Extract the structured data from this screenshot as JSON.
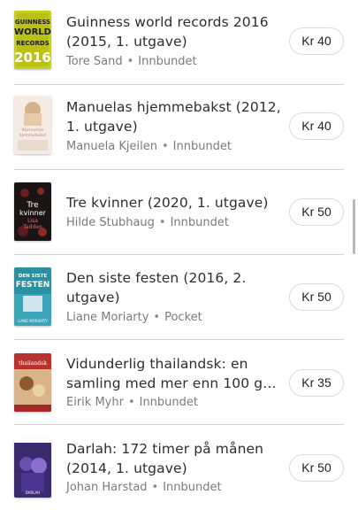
{
  "colors": {
    "divider": "#ecc3c6",
    "price_border": "#d9d9d9",
    "meta_text": "#7a7a7a"
  },
  "separator": "•",
  "books": [
    {
      "title_line1": "Guinness world records 2016",
      "title_line2": "(2015, 1. utgave)",
      "author": "Tore Sand",
      "format": "Innbundet",
      "price": "Kr 40",
      "cover_text": [
        "GUINNESS",
        "WORLD",
        "RECORDS",
        "2016"
      ]
    },
    {
      "title_line1": "Manuelas hjemmebakst (2012,",
      "title_line2": "1. utgave)",
      "author": "Manuela Kjeilen",
      "format": "Innbundet",
      "price": "Kr 40",
      "cover_text": [
        "Manuelas",
        "hjemmebakst"
      ]
    },
    {
      "title_line1": "Tre kvinner (2020, 1. utgave)",
      "title_line2": "",
      "author": "Hilde Stubhaug",
      "format": "Innbundet",
      "price": "Kr 50",
      "cover_text": [
        "Tre",
        "kvinner",
        "Lisa",
        "Taddeo"
      ]
    },
    {
      "title_line1": "Den siste festen (2016, 2.",
      "title_line2": "utgave)",
      "author": "Liane Moriarty",
      "format": "Pocket",
      "price": "Kr 50",
      "cover_text": [
        "DEN SISTE",
        "FESTEN",
        "LIANE MORIARTY"
      ]
    },
    {
      "title_line1": "Vidunderlig thailandsk: en",
      "title_line2": "samling med mer enn 100 gr...",
      "author": "Eirik Myhr",
      "format": "Innbundet",
      "price": "Kr 35",
      "cover_text": [
        "thailandsk"
      ]
    },
    {
      "title_line1": "Darlah: 172 timer på månen",
      "title_line2": "(2014, 1. utgave)",
      "author": "Johan Harstad",
      "format": "Innbundet",
      "price": "Kr 50",
      "cover_text": [
        "DARLAH"
      ]
    }
  ]
}
